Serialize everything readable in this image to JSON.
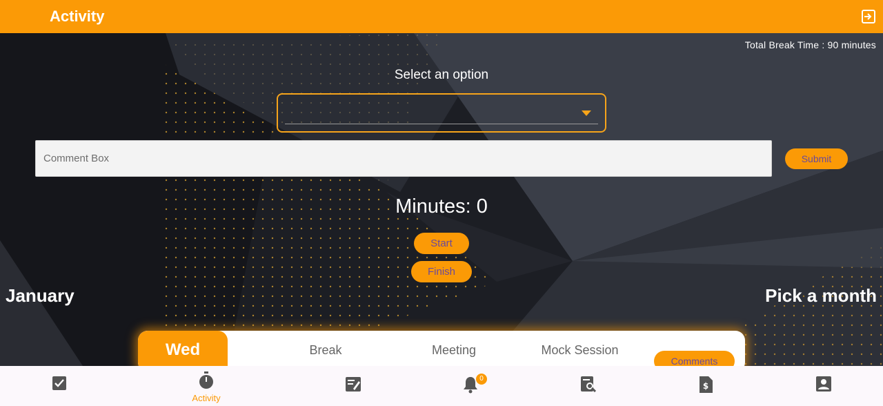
{
  "app_bar": {
    "title": "Activity",
    "logout_icon": "logout-icon"
  },
  "status": {
    "total_break": "Total Break Time : 90 minutes"
  },
  "selector": {
    "label": "Select an option",
    "value": ""
  },
  "comment": {
    "placeholder": "Comment Box",
    "value": ""
  },
  "buttons": {
    "submit": "Submit",
    "start": "Start",
    "finish": "Finish",
    "comments": "Comments"
  },
  "timer": {
    "text": "Minutes: 0"
  },
  "calendar": {
    "month": "January",
    "pick_label": "Pick a month"
  },
  "day_card": {
    "day": "Wed",
    "columns": [
      "Break",
      "Meeting",
      "Mock Session"
    ]
  },
  "bottom_nav": {
    "items": [
      {
        "icon": "checkbox-icon",
        "label": ""
      },
      {
        "icon": "stopwatch-icon",
        "label": "Activity",
        "active": true
      },
      {
        "icon": "edit-document-icon",
        "label": ""
      },
      {
        "icon": "bell-icon",
        "label": "",
        "badge": "0"
      },
      {
        "icon": "search-document-icon",
        "label": ""
      },
      {
        "icon": "invoice-icon",
        "label": ""
      },
      {
        "icon": "profile-icon",
        "label": ""
      }
    ]
  },
  "colors": {
    "accent": "#fb9a06",
    "background": "#1b1d23",
    "button_text": "#6a4a9a"
  }
}
